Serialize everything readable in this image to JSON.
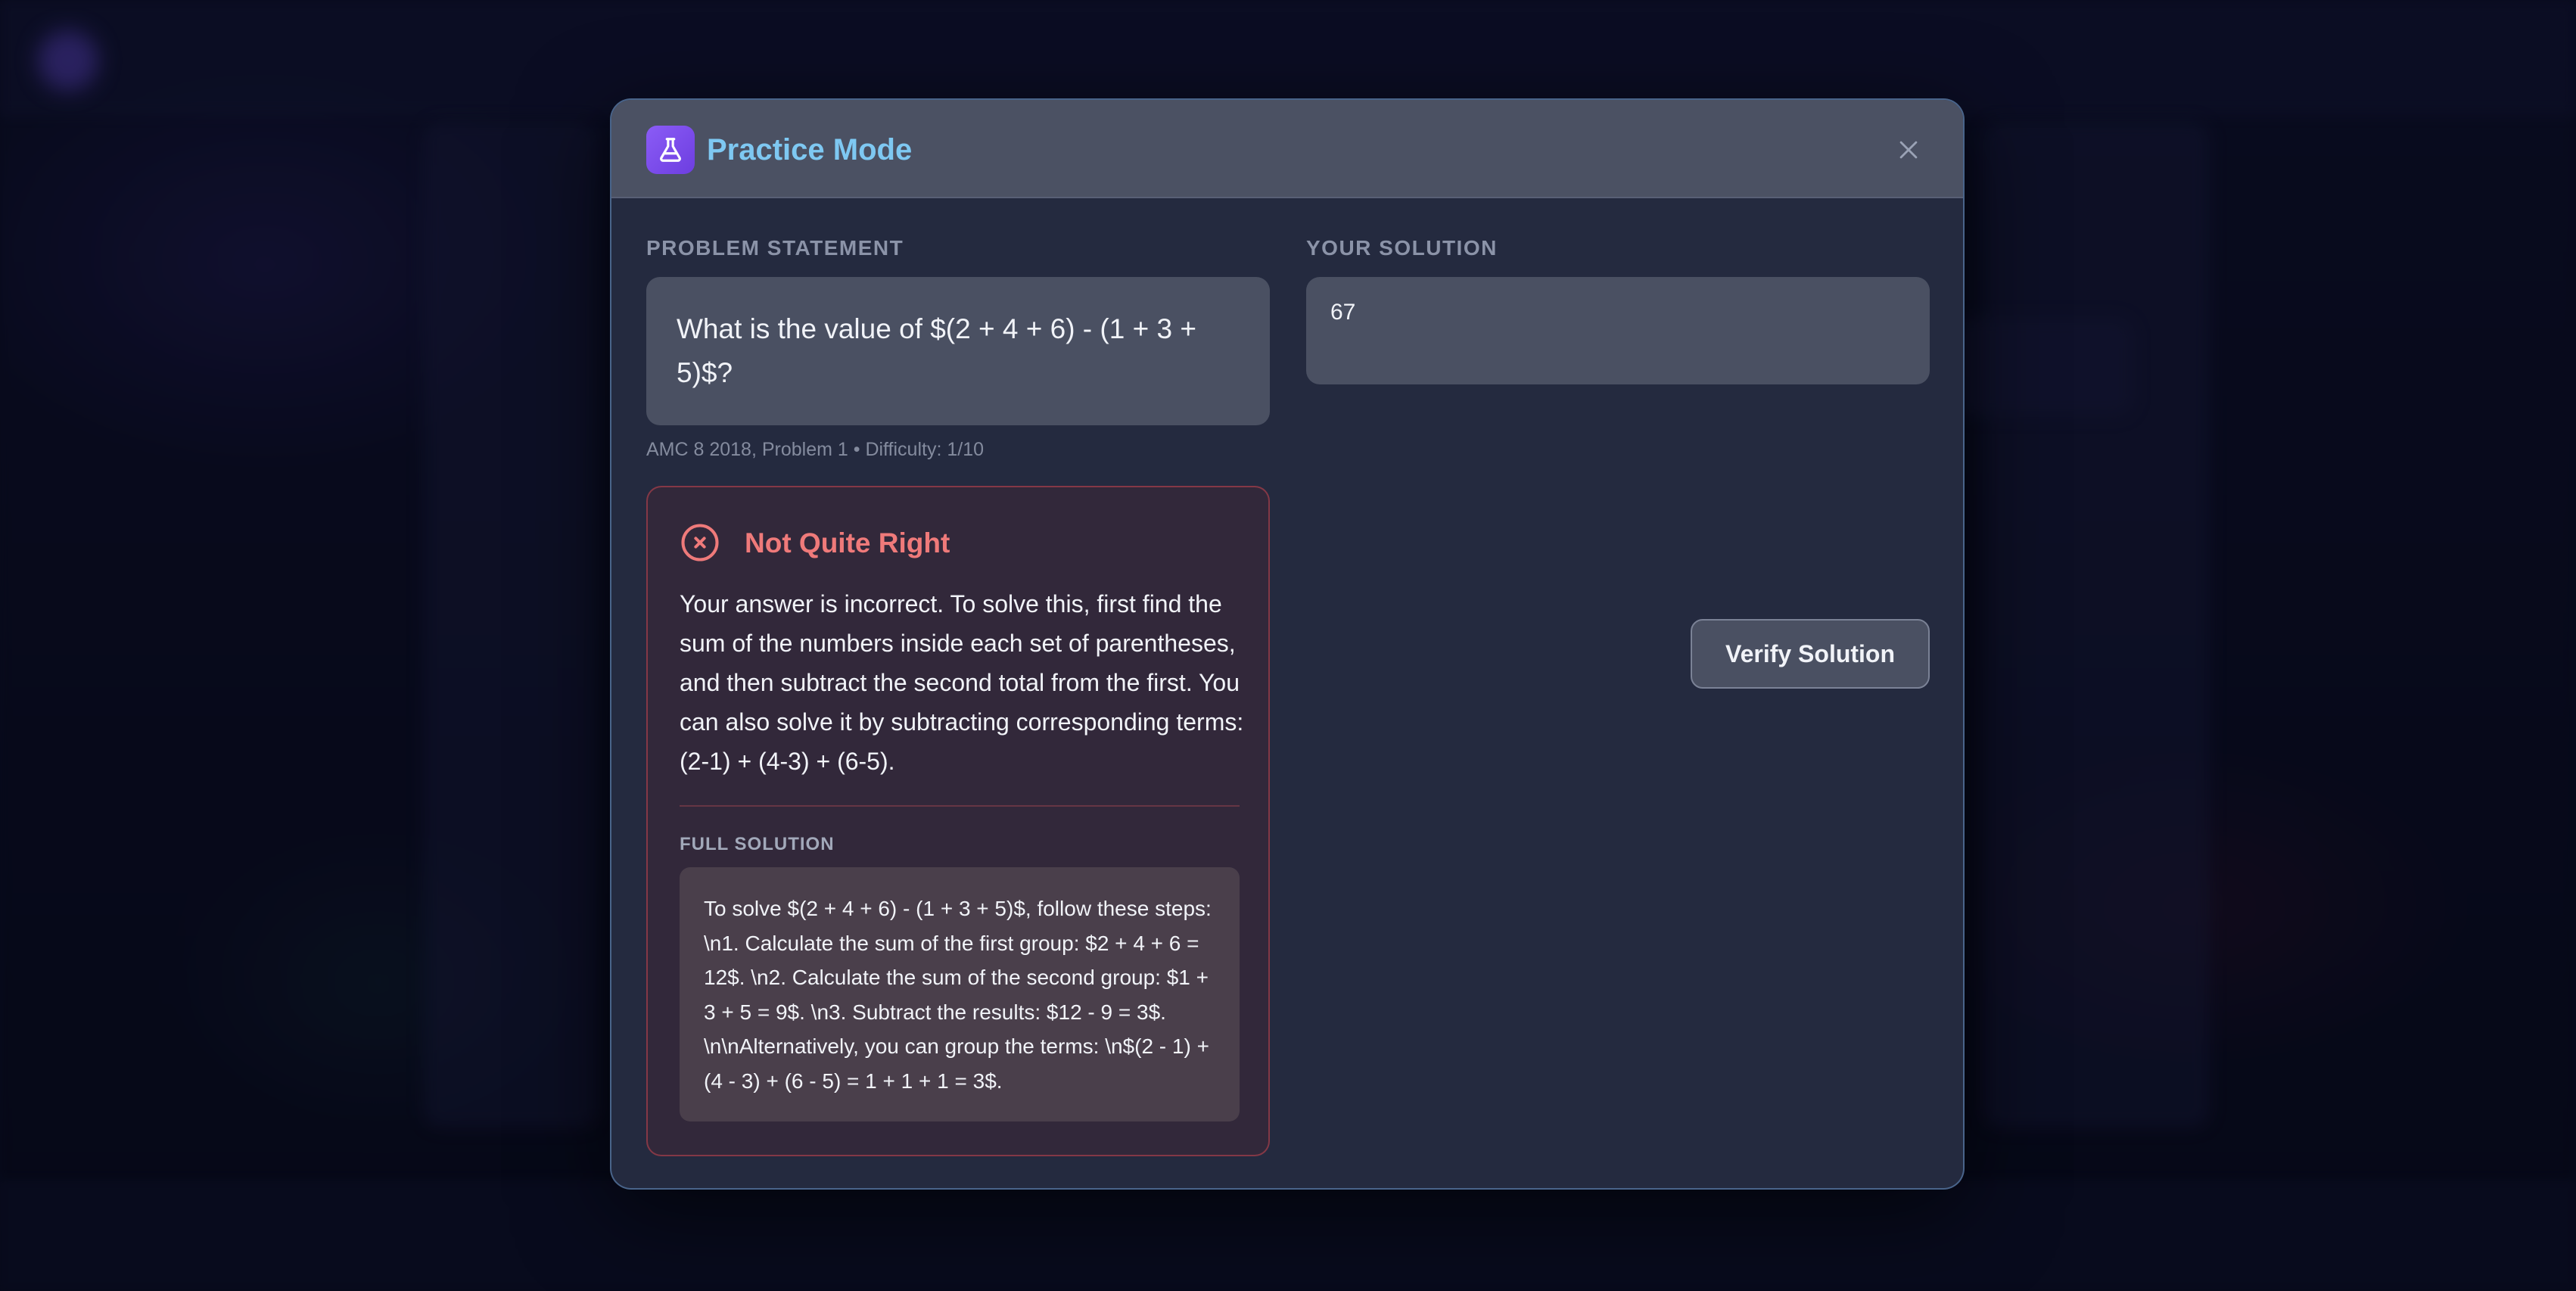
{
  "modal": {
    "title": "Practice Mode",
    "icon": "flask-icon",
    "close_icon": "close-icon"
  },
  "problem": {
    "label": "PROBLEM STATEMENT",
    "text": "What is the value of $(2 + 4 + 6) - (1 + 3 + 5)$?",
    "source": "AMC 8 2018, Problem 1 • Difficulty: 1/10"
  },
  "solution": {
    "label": "YOUR SOLUTION",
    "value": "67",
    "verify_label": "Verify Solution"
  },
  "feedback": {
    "icon": "x-circle-icon",
    "title": "Not Quite Right",
    "message": "Your answer is incorrect. To solve this, first find the sum of the numbers inside each set of parentheses, and then subtract the second total from the first. You can also solve it by subtracting corresponding terms: (2-1) + (4-3) + (6-5).",
    "full_solution_label": "FULL SOLUTION",
    "full_solution": "To solve $(2 + 4 + 6) - (1 + 3 + 5)$, follow these steps: \\n1. Calculate the sum of the first group: $2 + 4 + 6 = 12$. \\n2. Calculate the sum of the second group: $1 + 3 + 5 = 9$. \\n3. Subtract the results: $12 - 9 = 3$. \\n\\nAlternatively, you can group the terms: \\n$(2 - 1) + (4 - 3) + (6 - 5) = 1 + 1 + 1 = 3$."
  },
  "colors": {
    "accent_title": "#7ec8f2",
    "icon_purple": "#8b5cf6",
    "error": "#ef7a7a"
  }
}
